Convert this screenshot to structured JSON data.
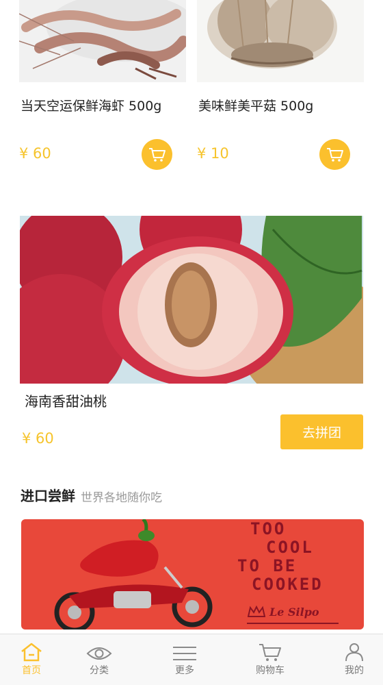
{
  "products": [
    {
      "name": "当天空运保鲜海虾  500g",
      "price": "¥ 60"
    },
    {
      "name": "美味鲜美平菇  500g",
      "price": "¥ 10"
    }
  ],
  "group_buy": {
    "name": "海南香甜油桃",
    "price": "¥ 60",
    "button": "去拼团"
  },
  "section": {
    "title": "进口尝鲜",
    "subtitle": "世界各地随你吃"
  },
  "banner": {
    "line1": "TOO",
    "line2": "COOL",
    "line3": "TO BE",
    "line4": "COOKED",
    "logo": "Le Silpo"
  },
  "tabbar": [
    {
      "label": "首页",
      "icon": "home-icon",
      "active": true
    },
    {
      "label": "分类",
      "icon": "eye-icon",
      "active": false
    },
    {
      "label": "更多",
      "icon": "menu-lines-icon",
      "active": false
    },
    {
      "label": "购物车",
      "icon": "cart-icon",
      "active": false
    },
    {
      "label": "我的",
      "icon": "user-icon",
      "active": false
    }
  ],
  "colors": {
    "accent": "#fbc02d",
    "price": "#f6c42c",
    "banner_bg": "#e8483a",
    "banner_text": "#8c1424"
  }
}
